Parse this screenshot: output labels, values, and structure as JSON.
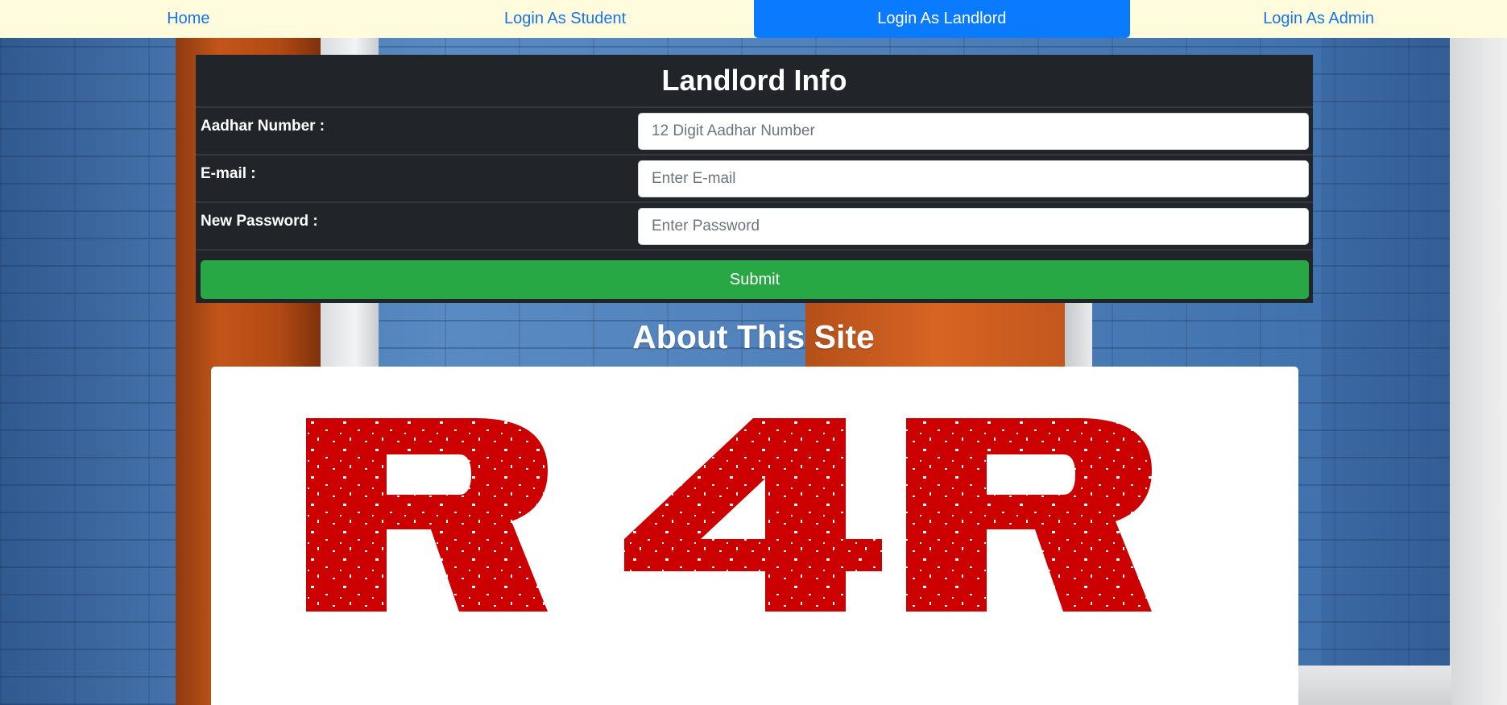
{
  "nav": {
    "items": [
      {
        "label": "Home",
        "active": false
      },
      {
        "label": "Login As Student",
        "active": false
      },
      {
        "label": "Login As Landlord",
        "active": true
      },
      {
        "label": "Login As Admin",
        "active": false
      }
    ]
  },
  "form": {
    "title": "Landlord Info",
    "fields": [
      {
        "label": "Aadhar Number :",
        "placeholder": "12 Digit Aadhar Number",
        "value": ""
      },
      {
        "label": "E-mail :",
        "placeholder": "Enter E-mail",
        "value": ""
      },
      {
        "label": "New Password :",
        "placeholder": "Enter Password",
        "value": ""
      }
    ],
    "submit_label": "Submit"
  },
  "about": {
    "title": "About This Site",
    "logo_text": "R4R"
  },
  "colors": {
    "nav_bg": "#fefcdc",
    "nav_link": "#1a73e8",
    "nav_active_bg": "#0a7bff",
    "card_bg": "#212529",
    "submit_bg": "#28a745",
    "logo_red": "#cc0000"
  }
}
